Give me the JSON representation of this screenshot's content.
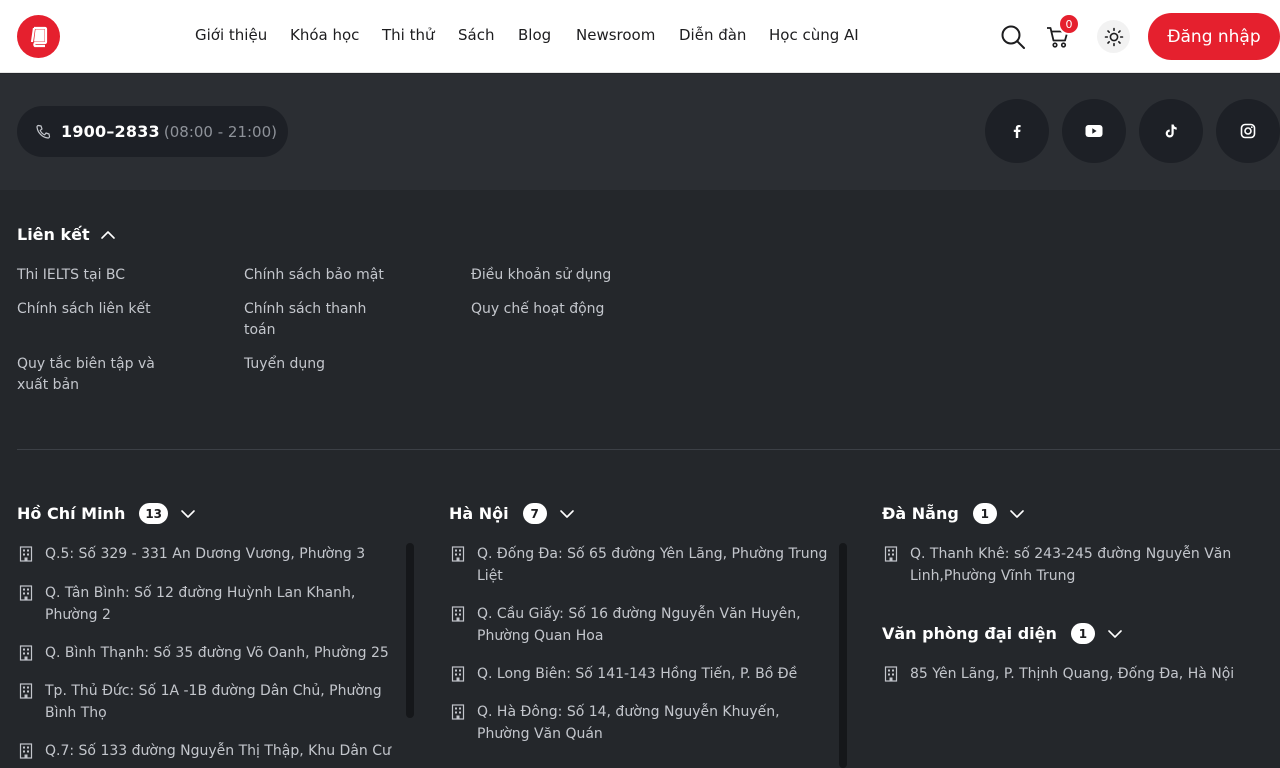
{
  "header": {
    "logo_icon": "book-icon",
    "nav": [
      "Giới thiệu",
      "Khóa học",
      "Thi thử",
      "Sách",
      "Blog",
      "Newsroom",
      "Diễn đàn",
      "Học cùng AI"
    ],
    "cart_count": "0",
    "login_label": "Đăng nhập",
    "accent_color": "#e5202e"
  },
  "contact": {
    "phone": "1900–2833",
    "hours": "(08:00 - 21:00)",
    "socials": [
      "facebook-icon",
      "youtube-icon",
      "tiktok-icon",
      "instagram-icon"
    ]
  },
  "links": {
    "title": "Liên kết",
    "items": [
      "Thi IELTS tại BC",
      "Chính sách bảo mật",
      "Điều khoản sử dụng",
      "Chính sách liên kết",
      "Chính sách thanh toán",
      "Quy chế hoạt động",
      "Quy tắc biên tập và xuất bản",
      "Tuyển dụng"
    ]
  },
  "offices": {
    "hcm": {
      "title": "Hồ Chí Minh",
      "count": "13",
      "items": [
        "Q.5: Số 329 - 331 An Dương Vương, Phường 3",
        "Q. Tân Bình: Số 12 đường Huỳnh Lan Khanh, Phường 2",
        "Q. Bình Thạnh: Số 35 đường Võ Oanh, Phường 25",
        "Tp. Thủ Đức: Số 1A -1B đường Dân Chủ, Phường Bình Thọ",
        "Q.7: Số 133 đường Nguyễn Thị Thập, Khu Dân Cư"
      ]
    },
    "hn": {
      "title": "Hà Nội",
      "count": "7",
      "items": [
        "Q. Đống Đa: Số 65 đường Yên Lãng, Phường Trung Liệt",
        "Q. Cầu Giấy: Số 16 đường Nguyễn Văn Huyên, Phường Quan Hoa",
        "Q. Long Biên: Số 141-143 Hồng Tiến, P. Bồ Đề",
        "Q. Hà Đông: Số 14, đường Nguyễn Khuyến, Phường Văn Quán"
      ]
    },
    "dn": {
      "title": "Đà Nẵng",
      "count": "1",
      "items": [
        "Q. Thanh Khê: số 243-245 đường Nguyễn Văn Linh,Phường Vĩnh Trung"
      ]
    },
    "rep": {
      "title": "Văn phòng đại diện",
      "count": "1",
      "items": [
        "85 Yên Lãng, P. Thịnh Quang, Đống Đa, Hà Nội"
      ]
    }
  }
}
